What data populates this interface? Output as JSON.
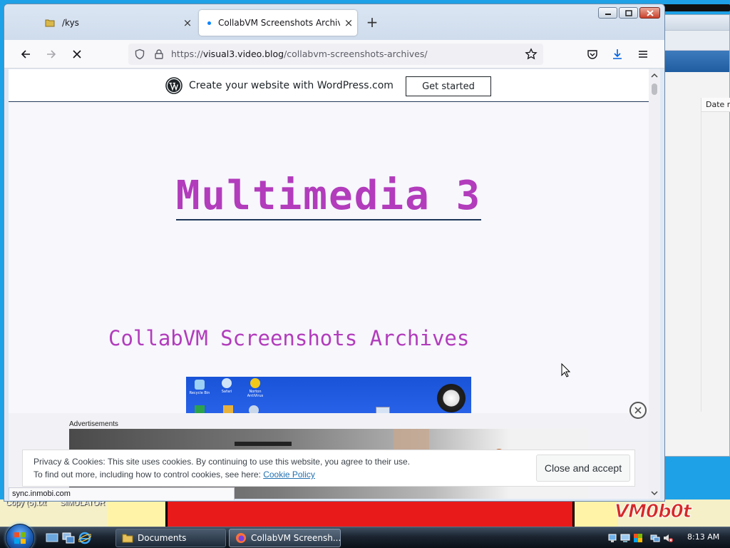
{
  "browser": {
    "tabs": [
      {
        "label": "/kys",
        "close": "×"
      },
      {
        "label": "CollabVM Screenshots Archives",
        "close": "×"
      }
    ],
    "new_tab": "+",
    "url": {
      "prefix": "https://",
      "host": "visual3.video.blog",
      "path": "/collabvm-screenshots-archives/"
    },
    "status_url": "sync.inmobi.com"
  },
  "page": {
    "banner_text": "Create your website with WordPress.com",
    "banner_button": "Get started",
    "site_title": "Multimedia 3",
    "archive_title": "CollabVM Screenshots Archives",
    "ads_label": "Advertisements",
    "thumbnail_icons": [
      "Recycle Bin",
      "Safari",
      "Norton AntiVirus"
    ]
  },
  "cookie": {
    "line1": "Privacy & Cookies: This site uses cookies. By continuing to use this website, you agree to their use.",
    "line2": "To find out more, including how to control cookies, see here: ",
    "link": "Cookie Policy",
    "button": "Close and accept"
  },
  "desktop": {
    "labels": [
      "Copy (5).txt",
      "SIMULATOR"
    ],
    "watermark": "VM0b0t",
    "background_window_column": "Date m"
  },
  "taskbar": {
    "tasks": [
      {
        "label": "Documents"
      },
      {
        "label": "CollabVM Screensh..."
      }
    ],
    "clock": "8:13 AM"
  },
  "colors": {
    "accent_magenta": "#b23cbc",
    "desktop_blue": "#1ea1e6",
    "firefox_blue": "#0a84ff"
  }
}
